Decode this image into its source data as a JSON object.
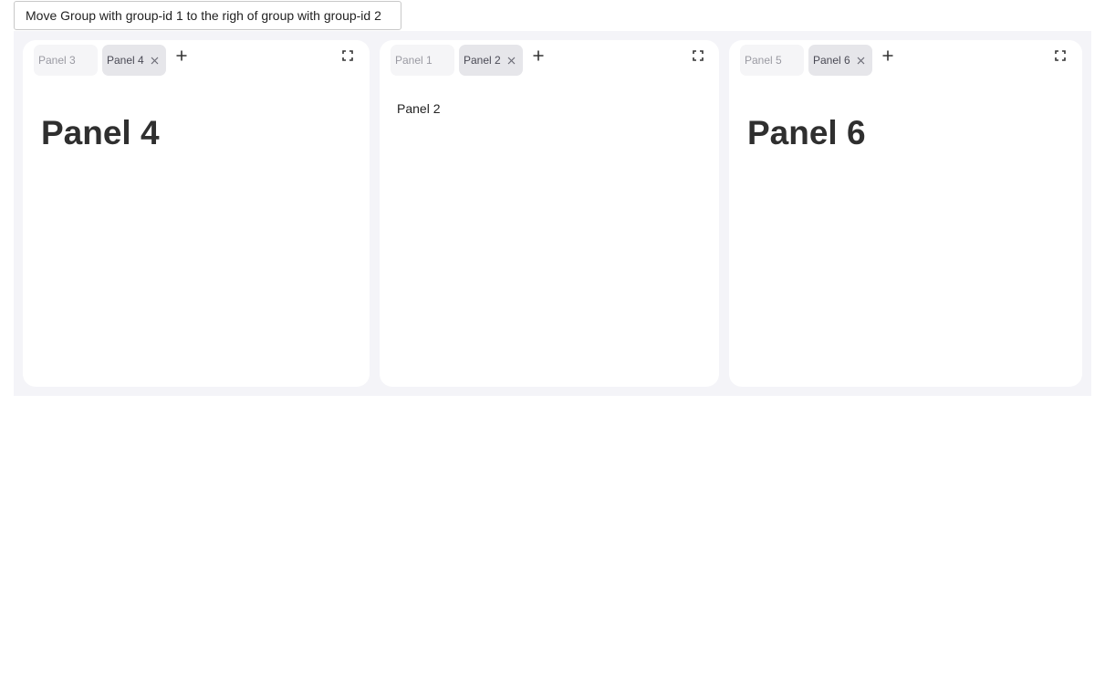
{
  "toolbar": {
    "move_button_label": "Move Group with group-id 1 to the righ of group with group-id 2"
  },
  "groups": [
    {
      "tabs": [
        {
          "label": "Panel 3",
          "active": false
        },
        {
          "label": "Panel 4",
          "active": true
        }
      ],
      "content_heading": "Panel 4"
    },
    {
      "tabs": [
        {
          "label": "Panel 1",
          "active": false
        },
        {
          "label": "Panel 2",
          "active": true
        }
      ],
      "content_text": "Panel 2"
    },
    {
      "tabs": [
        {
          "label": "Panel 5",
          "active": false
        },
        {
          "label": "Panel 6",
          "active": true
        }
      ],
      "content_heading": "Panel 6"
    }
  ],
  "icons": {
    "close": "close-icon",
    "add": "plus-icon",
    "maximize": "maximize-icon"
  },
  "colors": {
    "dock_background": "#f4f4f8",
    "active_tab": "#e6e6ea",
    "inactive_tab": "#f5f5f7"
  }
}
